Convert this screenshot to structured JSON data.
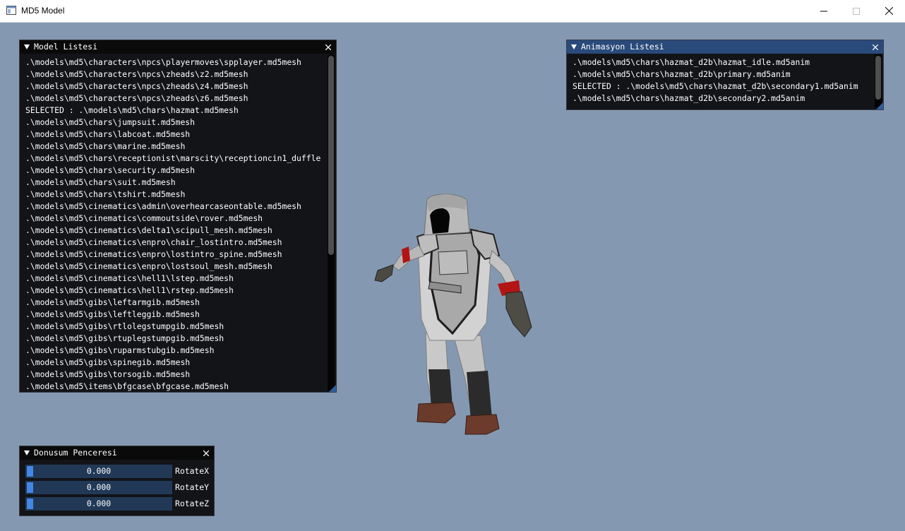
{
  "window": {
    "title": "MD5 Model",
    "icon": "app-window-icon",
    "controls": [
      "minimize-icon",
      "maximize-icon",
      "close-icon"
    ]
  },
  "model_panel": {
    "title": "Model Listesi",
    "items": [
      ".\\models\\md5\\characters\\npcs\\playermoves\\spplayer.md5mesh",
      ".\\models\\md5\\characters\\npcs\\zheads\\z2.md5mesh",
      ".\\models\\md5\\characters\\npcs\\zheads\\z4.md5mesh",
      ".\\models\\md5\\characters\\npcs\\zheads\\z6.md5mesh",
      "SELECTED : .\\models\\md5\\chars\\hazmat.md5mesh",
      ".\\models\\md5\\chars\\jumpsuit.md5mesh",
      ".\\models\\md5\\chars\\labcoat.md5mesh",
      ".\\models\\md5\\chars\\marine.md5mesh",
      ".\\models\\md5\\chars\\receptionist\\marscity\\receptioncin1_duffle",
      ".\\models\\md5\\chars\\security.md5mesh",
      ".\\models\\md5\\chars\\suit.md5mesh",
      ".\\models\\md5\\chars\\tshirt.md5mesh",
      ".\\models\\md5\\cinematics\\admin\\overhearcaseontable.md5mesh",
      ".\\models\\md5\\cinematics\\commoutside\\rover.md5mesh",
      ".\\models\\md5\\cinematics\\delta1\\scipull_mesh.md5mesh",
      ".\\models\\md5\\cinematics\\enpro\\chair_lostintro.md5mesh",
      ".\\models\\md5\\cinematics\\enpro\\lostintro_spine.md5mesh",
      ".\\models\\md5\\cinematics\\enpro\\lostsoul_mesh.md5mesh",
      ".\\models\\md5\\cinematics\\hell1\\lstep.md5mesh",
      ".\\models\\md5\\cinematics\\hell1\\rstep.md5mesh",
      ".\\models\\md5\\gibs\\leftarmgib.md5mesh",
      ".\\models\\md5\\gibs\\leftleggib.md5mesh",
      ".\\models\\md5\\gibs\\rtlolegstumpgib.md5mesh",
      ".\\models\\md5\\gibs\\rtuplegstumpgib.md5mesh",
      ".\\models\\md5\\gibs\\ruparmstubgib.md5mesh",
      ".\\models\\md5\\gibs\\spinegib.md5mesh",
      ".\\models\\md5\\gibs\\torsogib.md5mesh",
      ".\\models\\md5\\items\\bfgcase\\bfgcase.md5mesh"
    ]
  },
  "anim_panel": {
    "title": "Animasyon Listesi",
    "items": [
      ".\\models\\md5\\chars\\hazmat_d2b\\hazmat_idle.md5anim",
      ".\\models\\md5\\chars\\hazmat_d2b\\primary.md5anim",
      "SELECTED : .\\models\\md5\\chars\\hazmat_d2b\\secondary1.md5anim",
      ".\\models\\md5\\chars\\hazmat_d2b\\secondary2.md5anim"
    ]
  },
  "transform_panel": {
    "title": "Donusum Penceresi",
    "sliders": [
      {
        "label": "RotateX",
        "value": "0.000"
      },
      {
        "label": "RotateY",
        "value": "0.000"
      },
      {
        "label": "RotateZ",
        "value": "0.000"
      }
    ]
  },
  "colors": {
    "viewport_bg": "#8499b1",
    "panel_bg": "#0c0c0e",
    "title_active": "#294a7a",
    "slider_bg": "#213957",
    "slider_grab": "#4287e6"
  }
}
